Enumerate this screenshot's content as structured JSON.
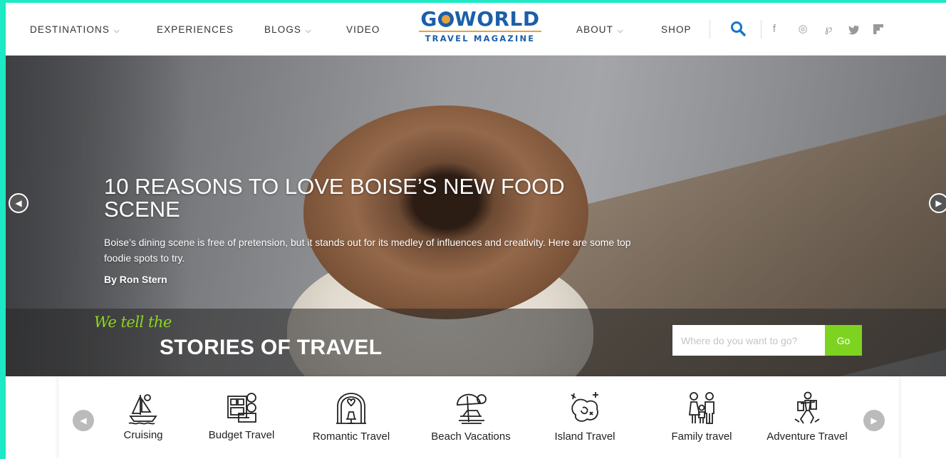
{
  "nav": {
    "items": [
      {
        "label": "DESTINATIONS",
        "dropdown": true
      },
      {
        "label": "EXPERIENCES",
        "dropdown": false
      },
      {
        "label": "BLOGS",
        "dropdown": true
      },
      {
        "label": "VIDEO",
        "dropdown": false
      },
      {
        "label": "ABOUT",
        "dropdown": true
      },
      {
        "label": "SHOP",
        "dropdown": false
      }
    ],
    "chevron": "⌵",
    "logo": {
      "top_left": "G",
      "top_right": "WORLD",
      "bottom": "TRAVEL MAGAZINE"
    },
    "search_icon": "search-icon",
    "social_icons": [
      "facebook-icon",
      "instagram-icon",
      "pinterest-icon",
      "twitter-icon",
      "flipboard-icon"
    ],
    "social_glyphs": [
      "f",
      "◎",
      "℘",
      "🐦",
      "▛"
    ]
  },
  "hero": {
    "title": "10 REASONS TO LOVE BOISE’S NEW FOOD SCENE",
    "description": "Boise’s dining scene is free of pretension, but it stands out for its medley of influences and creativity. Here are some top foodie spots to try.",
    "author": "By Ron Stern",
    "prev_glyph": "◀",
    "next_glyph": "▶"
  },
  "band": {
    "script_text": "We tell the",
    "main_text": "STORIES OF TRAVEL",
    "search_placeholder": "Where do you want to go?",
    "go_label": "Go"
  },
  "categories": {
    "prev_glyph": "◀",
    "next_glyph": "▶",
    "items": [
      {
        "label": "Cruising",
        "icon": "sailboat-icon"
      },
      {
        "label": "Budget Travel",
        "icon": "wallet-icon"
      },
      {
        "label": "Romantic Travel",
        "icon": "arch-icon"
      },
      {
        "label": "Beach Vacations",
        "icon": "beach-chair-icon"
      },
      {
        "label": "Island Travel",
        "icon": "island-map-icon"
      },
      {
        "label": "Family travel",
        "icon": "family-icon"
      },
      {
        "label": "Adventure Travel",
        "icon": "adventure-icon"
      }
    ]
  },
  "colors": {
    "accent_green": "#7ed321",
    "logo_blue": "#1b5fa8",
    "border_teal": "#1de9c4"
  }
}
